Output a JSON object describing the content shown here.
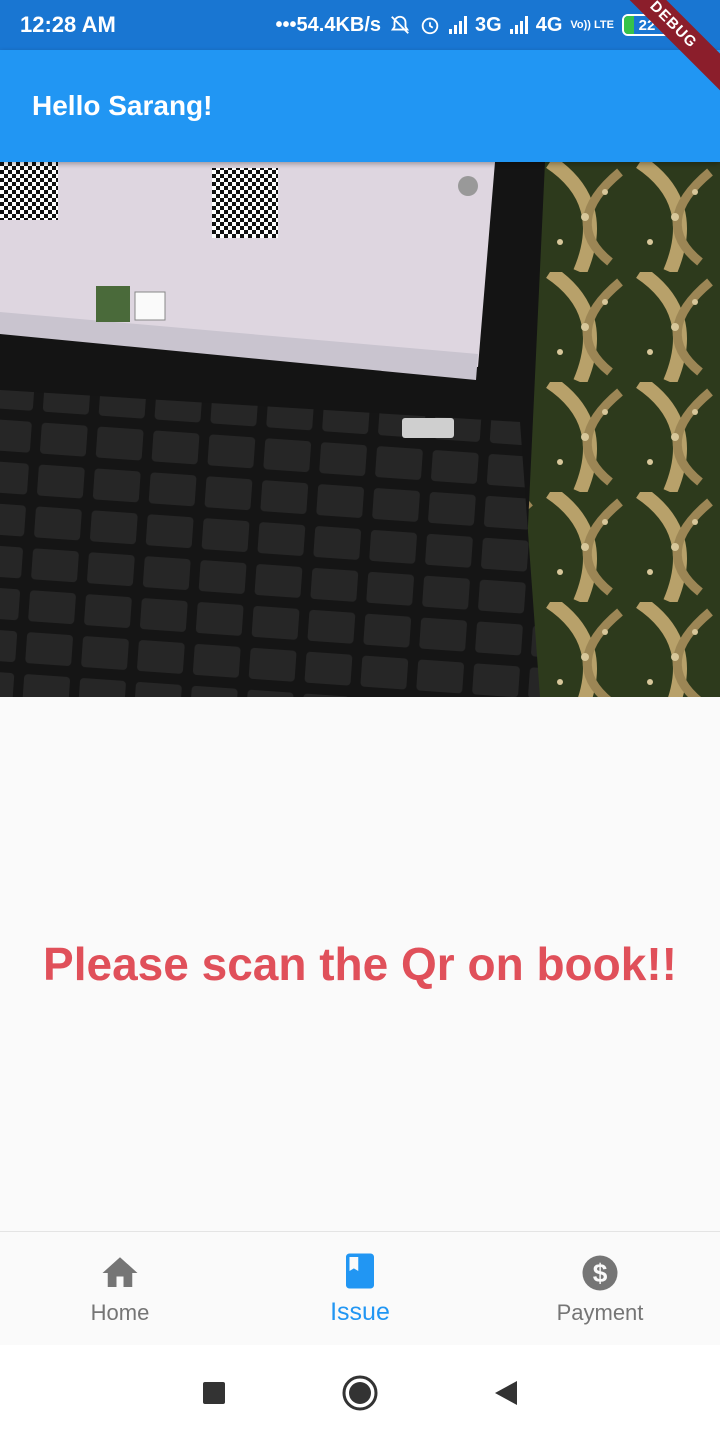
{
  "status_bar": {
    "time": "12:28 AM",
    "network_speed": "•••54.4KB/s",
    "network_3g": "3G",
    "network_4g": "4G",
    "volte": "Vo)) LTE",
    "battery": "22",
    "battery_level": 0.22,
    "icons": [
      "mute-icon",
      "alarm-icon",
      "signal-icon",
      "signal-icon",
      "battery-icon"
    ]
  },
  "debug_banner": "DEBUG",
  "app_bar": {
    "title": "Hello Sarang!"
  },
  "main": {
    "message": "Please scan the Qr on book!!"
  },
  "bottom_nav": {
    "items": [
      {
        "label": "Home",
        "icon": "home-icon",
        "active": false
      },
      {
        "label": "Issue",
        "icon": "book-icon",
        "active": true
      },
      {
        "label": "Payment",
        "icon": "dollar-icon",
        "active": false
      }
    ]
  },
  "colors": {
    "primary": "#2196f3",
    "status_bar": "#1976d2",
    "message": "#e0505a",
    "inactive": "#757575",
    "debug": "#8b1e2b"
  }
}
